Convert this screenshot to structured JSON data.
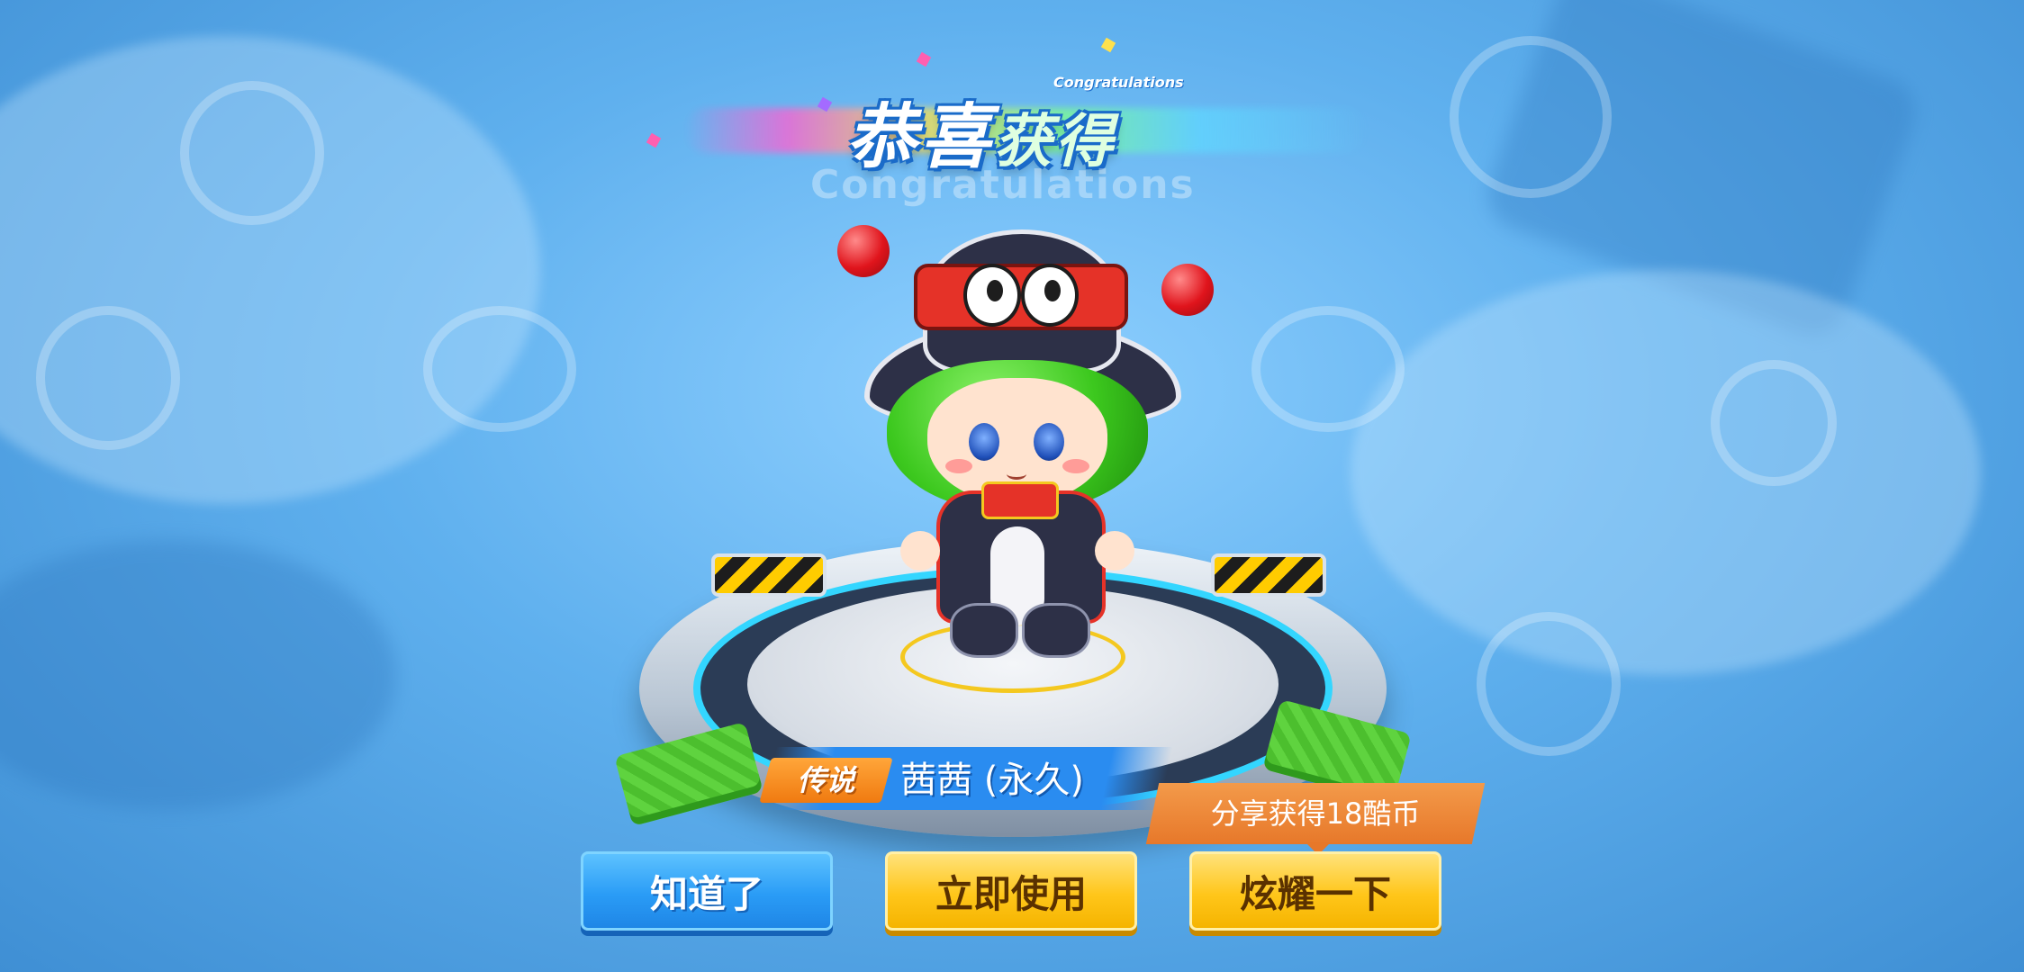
{
  "title": {
    "main_part1": "恭喜",
    "main_part2": "获得",
    "small_english": "Congratulations",
    "ghost_english": "Congratulations"
  },
  "reward": {
    "rarity": "传说",
    "name": "茜茜 (永久)"
  },
  "share_tip": {
    "text": "分享获得18酷币"
  },
  "buttons": {
    "ok_label": "知道了",
    "use_label": "立即使用",
    "show_label": "炫耀一下"
  },
  "colors": {
    "blue_button": "#2a9cf6",
    "yellow_button": "#ffc61a",
    "rarity_orange": "#f07a10",
    "share_orange": "#e7782a"
  }
}
